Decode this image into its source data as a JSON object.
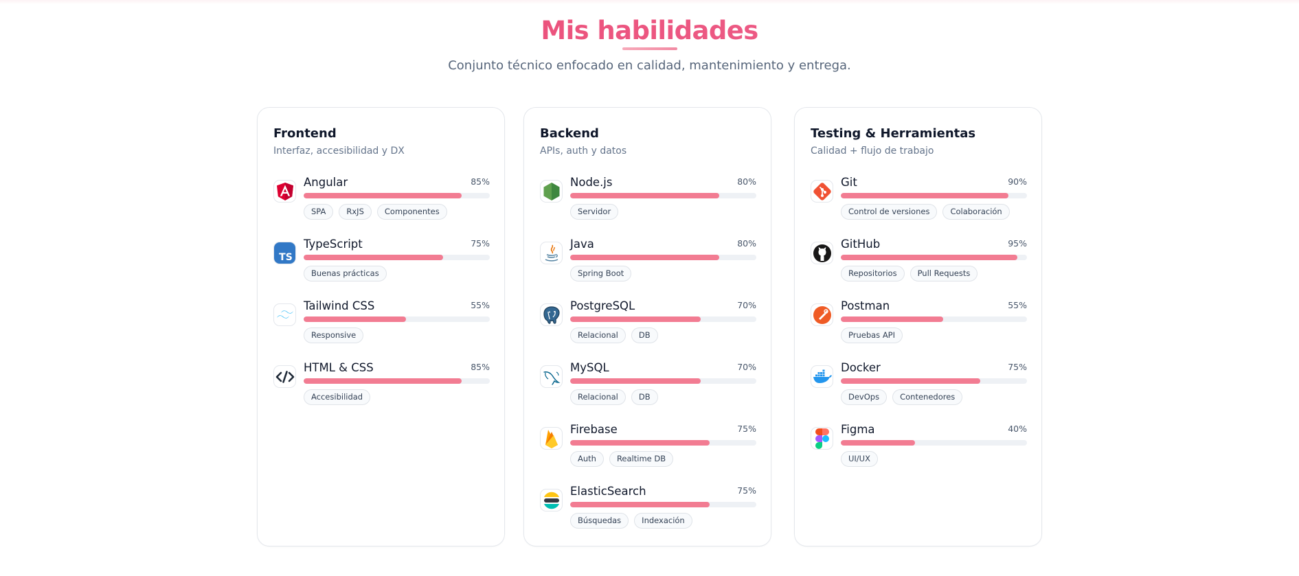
{
  "section": {
    "title": "Mis habilidades",
    "subtitle": "Conjunto técnico enfocado en calidad, mantenimiento y entrega."
  },
  "colors": {
    "accent": "#f27c92",
    "title_gradient": [
      "#e8416b",
      "#f06b96"
    ],
    "track": "#eef1f5"
  },
  "cards": [
    {
      "title": "Frontend",
      "subtitle": "Interfaz, accesibilidad y DX",
      "skills": [
        {
          "name": "Angular",
          "percent_label": "85%",
          "level": 0.85,
          "icon": "angular-icon",
          "tags": [
            "SPA",
            "RxJS",
            "Componentes"
          ]
        },
        {
          "name": "TypeScript",
          "percent_label": "75%",
          "level": 0.75,
          "icon": "typescript-icon",
          "tags": [
            "Buenas prácticas"
          ]
        },
        {
          "name": "Tailwind CSS",
          "percent_label": "55%",
          "level": 0.55,
          "icon": "tailwind-icon",
          "tags": [
            "Responsive"
          ]
        },
        {
          "name": "HTML & CSS",
          "percent_label": "85%",
          "level": 0.85,
          "icon": "code-icon",
          "tags": [
            "Accesibilidad"
          ]
        }
      ]
    },
    {
      "title": "Backend",
      "subtitle": "APIs, auth y datos",
      "skills": [
        {
          "name": "Node.js",
          "percent_label": "80%",
          "level": 0.8,
          "icon": "nodejs-icon",
          "tags": [
            "Servidor"
          ]
        },
        {
          "name": "Java",
          "percent_label": "80%",
          "level": 0.8,
          "icon": "java-icon",
          "tags": [
            "Spring Boot"
          ]
        },
        {
          "name": "PostgreSQL",
          "percent_label": "70%",
          "level": 0.7,
          "icon": "postgresql-icon",
          "tags": [
            "Relacional",
            "DB"
          ]
        },
        {
          "name": "MySQL",
          "percent_label": "70%",
          "level": 0.7,
          "icon": "mysql-icon",
          "tags": [
            "Relacional",
            "DB"
          ]
        },
        {
          "name": "Firebase",
          "percent_label": "75%",
          "level": 0.75,
          "icon": "firebase-icon",
          "tags": [
            "Auth",
            "Realtime DB"
          ]
        },
        {
          "name": "ElasticSearch",
          "percent_label": "75%",
          "level": 0.75,
          "icon": "elasticsearch-icon",
          "tags": [
            "Búsquedas",
            "Indexación"
          ]
        }
      ]
    },
    {
      "title": "Testing & Herramientas",
      "subtitle": "Calidad + flujo de trabajo",
      "skills": [
        {
          "name": "Git",
          "percent_label": "90%",
          "level": 0.9,
          "icon": "git-icon",
          "tags": [
            "Control de versiones",
            "Colaboración"
          ]
        },
        {
          "name": "GitHub",
          "percent_label": "95%",
          "level": 0.95,
          "icon": "github-icon",
          "tags": [
            "Repositorios",
            "Pull Requests"
          ]
        },
        {
          "name": "Postman",
          "percent_label": "55%",
          "level": 0.55,
          "icon": "postman-icon",
          "tags": [
            "Pruebas API"
          ]
        },
        {
          "name": "Docker",
          "percent_label": "75%",
          "level": 0.75,
          "icon": "docker-icon",
          "tags": [
            "DevOps",
            "Contenedores"
          ]
        },
        {
          "name": "Figma",
          "percent_label": "40%",
          "level": 0.4,
          "icon": "figma-icon",
          "tags": [
            "UI/UX"
          ]
        }
      ]
    }
  ]
}
